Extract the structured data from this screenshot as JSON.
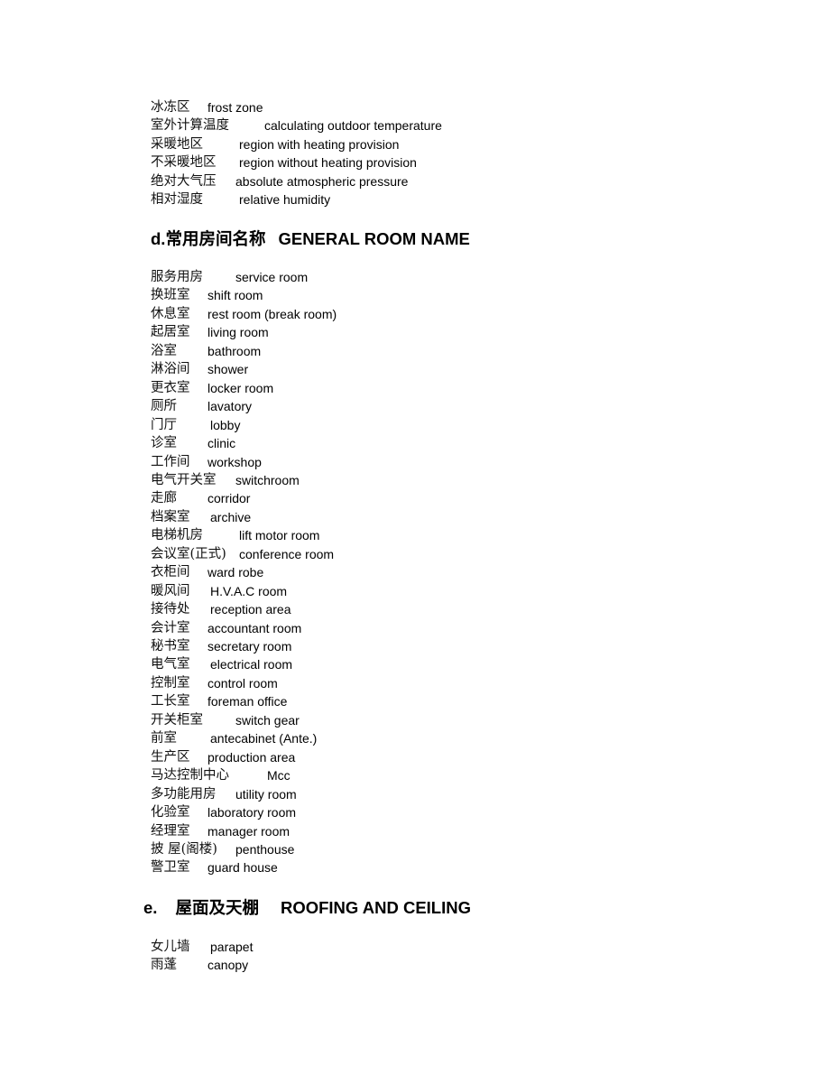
{
  "section_c_terms": [
    {
      "zh": "冰冻区",
      "en": "frost zone"
    },
    {
      "zh": "室外计算温度",
      "en": "calculating outdoor temperature"
    },
    {
      "zh": "采暖地区",
      "en": "region with heating provision"
    },
    {
      "zh": "不采暖地区",
      "en": "region without heating provision"
    },
    {
      "zh": "绝对大气压",
      "en": "absolute atmospheric pressure"
    },
    {
      "zh": "相对湿度",
      "en": "relative humidity"
    }
  ],
  "section_d": {
    "heading_prefix": "d.",
    "heading_zh": "常用房间名称",
    "heading_en": "GENERAL ROOM NAME",
    "terms": [
      {
        "zh": "服务用房",
        "en": "service room"
      },
      {
        "zh": "换班室",
        "en": "shift room"
      },
      {
        "zh": "休息室",
        "en": "rest room (break room)"
      },
      {
        "zh": "起居室",
        "en": "living room"
      },
      {
        "zh": "浴室",
        "en": "bathroom"
      },
      {
        "zh": "淋浴间",
        "en": "shower"
      },
      {
        "zh": "更衣室",
        "en": "locker room"
      },
      {
        "zh": "厕所",
        "en": "lavatory"
      },
      {
        "zh": "门厅",
        "en": "lobby"
      },
      {
        "zh": "诊室",
        "en": "clinic"
      },
      {
        "zh": "工作间",
        "en": "workshop"
      },
      {
        "zh": "电气开关室",
        "en": "switchroom"
      },
      {
        "zh": "走廊",
        "en": "corridor"
      },
      {
        "zh": "档案室",
        "en": "archive"
      },
      {
        "zh": "电梯机房",
        "en": "lift motor room"
      },
      {
        "zh": "会议室(正式)",
        "en": "conference room"
      },
      {
        "zh": "衣柜间",
        "en": "ward robe"
      },
      {
        "zh": "暖风间",
        "en": "H.V.A.C room"
      },
      {
        "zh": "接待处",
        "en": "reception area"
      },
      {
        "zh": "会计室",
        "en": "accountant room"
      },
      {
        "zh": "秘书室",
        "en": "secretary room"
      },
      {
        "zh": "电气室",
        "en": "electrical room"
      },
      {
        "zh": "控制室",
        "en": "control room"
      },
      {
        "zh": "工长室",
        "en": "foreman office"
      },
      {
        "zh": "开关柜室",
        "en": "switch gear"
      },
      {
        "zh": "前室",
        "en": "antecabinet (Ante.)"
      },
      {
        "zh": "生产区",
        "en": "production area"
      },
      {
        "zh": "马达控制中心",
        "en": "Mcc"
      },
      {
        "zh": "多功能用房",
        "en": "utility room"
      },
      {
        "zh": "化验室",
        "en": "laboratory room"
      },
      {
        "zh": "经理室",
        "en": "manager room"
      },
      {
        "zh": "披  屋(阁楼)",
        "en": "penthouse"
      },
      {
        "zh": "警卫室",
        "en": "guard house"
      }
    ]
  },
  "section_e": {
    "heading_prefix": "e.",
    "heading_zh": "屋面及天棚",
    "heading_en": "ROOFING AND CEILING",
    "terms": [
      {
        "zh": "女儿墙",
        "en": "parapet"
      },
      {
        "zh": "雨蓬",
        "en": "canopy"
      }
    ]
  }
}
